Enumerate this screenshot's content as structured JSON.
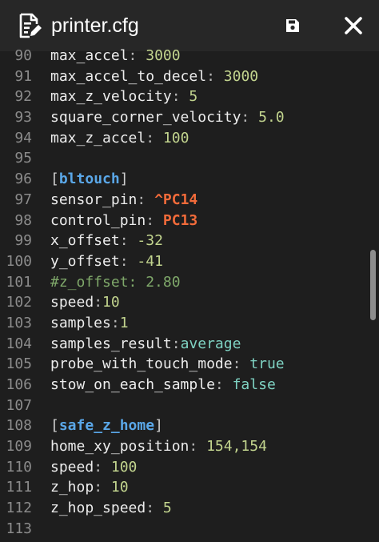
{
  "header": {
    "title": "printer.cfg",
    "icons": {
      "doc": "edit-document-icon",
      "save": "save-icon",
      "close": "close-icon"
    }
  },
  "lines": [
    {
      "n": "90",
      "key": "max_accel",
      "sep": ": ",
      "val": "3000",
      "kind": "num"
    },
    {
      "n": "91",
      "key": "max_accel_to_decel",
      "sep": ": ",
      "val": "3000",
      "kind": "num"
    },
    {
      "n": "92",
      "key": "max_z_velocity",
      "sep": ": ",
      "val": "5",
      "kind": "num"
    },
    {
      "n": "93",
      "key": "square_corner_velocity",
      "sep": ": ",
      "val": "5.0",
      "kind": "num"
    },
    {
      "n": "94",
      "key": "max_z_accel",
      "sep": ": ",
      "val": "100",
      "kind": "num"
    },
    {
      "n": "95",
      "kind": "blank"
    },
    {
      "n": "96",
      "kind": "section",
      "section": "bltouch"
    },
    {
      "n": "97",
      "key": "sensor_pin",
      "sep": ": ",
      "val": "^PC14",
      "kind": "pin"
    },
    {
      "n": "98",
      "key": "control_pin",
      "sep": ": ",
      "val": "PC13",
      "kind": "pin"
    },
    {
      "n": "99",
      "key": "x_offset",
      "sep": ": ",
      "val": "-32",
      "kind": "num"
    },
    {
      "n": "100",
      "key": "y_offset",
      "sep": ": ",
      "val": "-41",
      "kind": "num"
    },
    {
      "n": "101",
      "kind": "comment",
      "text": "#z_offset: 2.80"
    },
    {
      "n": "102",
      "key": "speed",
      "sep": ":",
      "val": "10",
      "kind": "num"
    },
    {
      "n": "103",
      "key": "samples",
      "sep": ":",
      "val": "1",
      "kind": "num"
    },
    {
      "n": "104",
      "key": "samples_result",
      "sep": ":",
      "val": "average",
      "kind": "bool"
    },
    {
      "n": "105",
      "key": "probe_with_touch_mode",
      "sep": ": ",
      "val": "true",
      "kind": "bool"
    },
    {
      "n": "106",
      "key": "stow_on_each_sample",
      "sep": ": ",
      "val": "false",
      "kind": "bool"
    },
    {
      "n": "107",
      "kind": "blank"
    },
    {
      "n": "108",
      "kind": "section",
      "section": "safe_z_home"
    },
    {
      "n": "109",
      "key": "home_xy_position",
      "sep": ": ",
      "val": "154,154",
      "kind": "num"
    },
    {
      "n": "110",
      "key": "speed",
      "sep": ": ",
      "val": "100",
      "kind": "num"
    },
    {
      "n": "111",
      "key": "z_hop",
      "sep": ": ",
      "val": "10",
      "kind": "num"
    },
    {
      "n": "112",
      "key": "z_hop_speed",
      "sep": ": ",
      "val": "5",
      "kind": "num"
    },
    {
      "n": "113",
      "kind": "blank"
    }
  ],
  "colors": {
    "background": "#1e1e1e",
    "header": "#272727",
    "line_number": "#8b8b8b",
    "number_value": "#c2d48e",
    "bool_value": "#7fd3c3",
    "pin_value": "#f26b3a",
    "comment": "#7fa86a",
    "section": "#5aa7e8"
  }
}
